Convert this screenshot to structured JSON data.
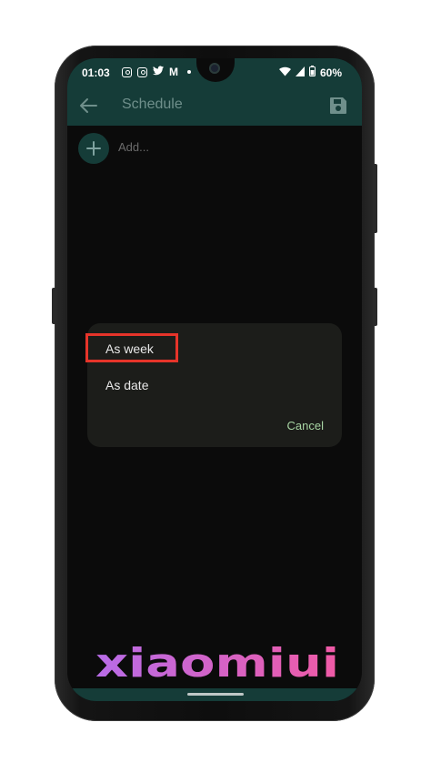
{
  "status_bar": {
    "time": "01:03",
    "battery": "60%",
    "icons_left": [
      "instagram-icon",
      "instagram-icon",
      "twitter-icon",
      "gmail-icon",
      "dot"
    ],
    "icons_right": [
      "wifi-icon",
      "signal-icon",
      "battery-icon"
    ]
  },
  "appbar": {
    "title": "Schedule",
    "back_icon": "arrow-left-icon",
    "save_icon": "save-icon"
  },
  "add": {
    "label": "Add..."
  },
  "dialog": {
    "options": [
      "As week",
      "As date"
    ],
    "cancel_label": "Cancel",
    "highlighted_option": "As week"
  },
  "watermark": {
    "text": "xiaomiui"
  },
  "colors": {
    "teal_bar": "#153c38",
    "dialog_bg": "#1c1d1a",
    "cancel_green": "#a7d4a3",
    "highlight_red": "#e6342a",
    "watermark_purple": "#b86ce8",
    "watermark_pink": "#f05aa5"
  }
}
